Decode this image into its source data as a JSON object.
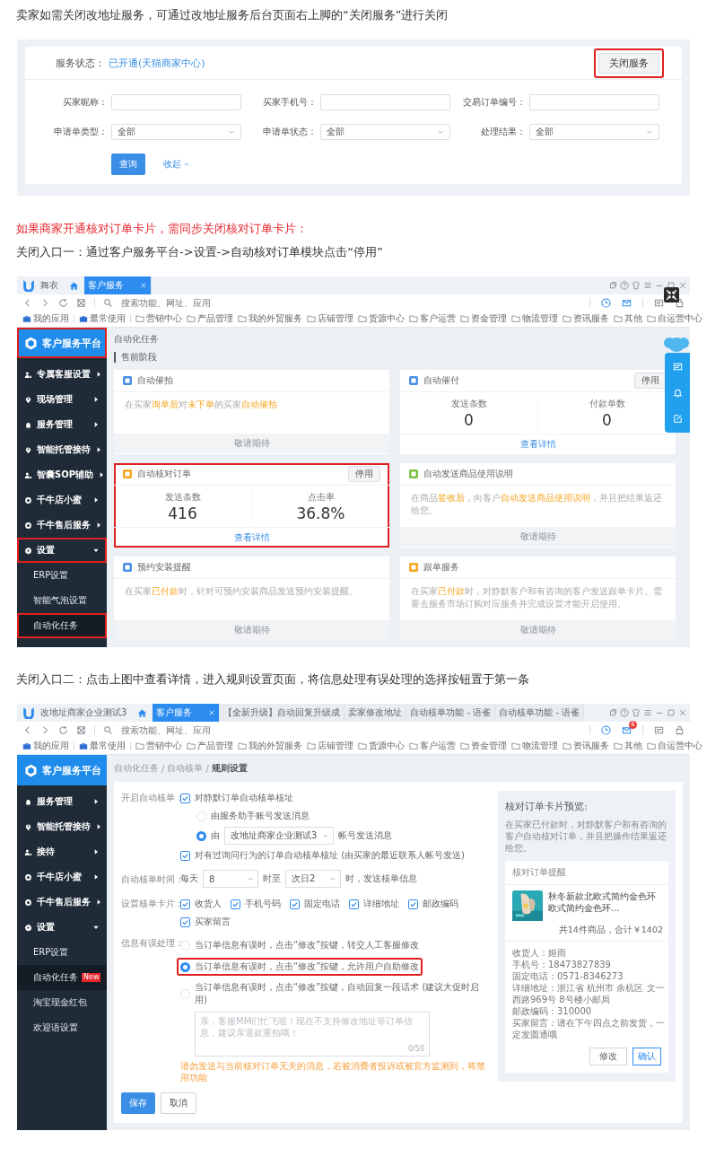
{
  "blocks": [
    {
      "kind": "paragraph",
      "alert": false,
      "text": "卖家如需关闭改地址服务，可通过改地址服务后台页面右上脚的“关闭服务”进行关闭"
    },
    {
      "kind": "service_panel",
      "status_label": "服务状态：",
      "status_value": "已开通(天猫商家中心)",
      "close_button": {
        "label": "关闭服务",
        "highlighted": true
      },
      "fields": [
        {
          "label": "买家昵称：",
          "kind": "input"
        },
        {
          "label": "买家手机号：",
          "kind": "input"
        },
        {
          "label": "交易订单编号：",
          "kind": "input"
        },
        {
          "label": "申请单类型：",
          "kind": "select",
          "value": "全部"
        },
        {
          "label": "申请单状态：",
          "kind": "select",
          "value": "全部"
        },
        {
          "label": "处理结果：",
          "kind": "select",
          "value": "全部"
        }
      ],
      "query_button": "查询",
      "collapse_link": "收起"
    },
    {
      "kind": "paragraph",
      "alert": true,
      "text": "如果商家开通核对订单卡片，需同步关闭核对订单卡片："
    },
    {
      "kind": "paragraph",
      "alert": false,
      "text": "关闭入口一：通过客户服务平台->设置->自动核对订单模块点击“停用”"
    },
    {
      "kind": "client_window",
      "zoom_overlay": true,
      "app_name": "舞衣",
      "tabs": [
        {
          "label": "客户服务",
          "selected": true
        }
      ],
      "search_placeholder": "搜索功能、网址、应用",
      "bookmarks": [
        {
          "label": "我的应用",
          "kind": "group"
        },
        {
          "label": "最常使用",
          "kind": "group"
        },
        {
          "label": "营销中心",
          "kind": "folder"
        },
        {
          "label": "产品管理",
          "kind": "folder"
        },
        {
          "label": "我的外贸服务",
          "kind": "folder"
        },
        {
          "label": "店铺管理",
          "kind": "folder"
        },
        {
          "label": "货源中心",
          "kind": "folder"
        },
        {
          "label": "客户运营",
          "kind": "folder"
        },
        {
          "label": "资金管理",
          "kind": "folder"
        },
        {
          "label": "物流管理",
          "kind": "folder"
        },
        {
          "label": "资讯服务",
          "kind": "folder"
        },
        {
          "label": "其他",
          "kind": "folder"
        },
        {
          "label": "自运营中心",
          "kind": "folder"
        }
      ],
      "sidebar": {
        "title": "客户服务平台",
        "highlighted": true,
        "items": [
          {
            "label": "专属客服设置",
            "expanded": false,
            "highlighted": false
          },
          {
            "label": "现场管理",
            "expanded": false,
            "highlighted": false
          },
          {
            "label": "服务管理",
            "expanded": false,
            "highlighted": false
          },
          {
            "label": "智能托管接待",
            "expanded": false,
            "highlighted": false
          },
          {
            "label": "智囊SOP辅助",
            "expanded": false,
            "highlighted": false
          },
          {
            "label": "千牛店小蜜",
            "expanded": false,
            "highlighted": false
          },
          {
            "label": "千牛售后服务",
            "expanded": false,
            "highlighted": false
          },
          {
            "label": "设置",
            "expanded": true,
            "highlighted": true,
            "children": [
              {
                "label": "ERP设置",
                "selected": false,
                "highlighted": false
              },
              {
                "label": "智能气泡设置",
                "selected": false,
                "highlighted": false
              },
              {
                "label": "自动化任务",
                "selected": true,
                "highlighted": true
              }
            ]
          }
        ]
      },
      "page": {
        "kind": "task_list",
        "title": "自动化任务",
        "section": "售前阶段",
        "cards": [
          {
            "title": "自动催拍",
            "color": "#4a90e2",
            "kind": "description",
            "highlighted": false,
            "description": [
              {
                "text": "在买家",
                "highlight": false
              },
              {
                "text": "询单后",
                "highlight": true
              },
              {
                "text": "对",
                "highlight": false
              },
              {
                "text": "未下单",
                "highlight": true
              },
              {
                "text": "的买家",
                "highlight": false
              },
              {
                "text": "自动催拍",
                "highlight": true
              }
            ],
            "footer": "敬请期待"
          },
          {
            "title": "自动催付",
            "color": "#4a90e2",
            "kind": "stats",
            "highlighted": false,
            "action": "停用",
            "stats": [
              {
                "label": "发送条数",
                "value": "0"
              },
              {
                "label": "付款单数",
                "value": "0"
              }
            ],
            "footer": "查看详情"
          },
          {
            "title": "自动核对订单",
            "color": "#f5a623",
            "kind": "stats",
            "highlighted": true,
            "action": "停用",
            "stats": [
              {
                "label": "发送条数",
                "value": "416"
              },
              {
                "label": "点击率",
                "value": "36.8%"
              }
            ],
            "footer": "查看详情"
          },
          {
            "title": "自动发送商品使用说明",
            "color": "#7ac143",
            "kind": "description",
            "highlighted": false,
            "description": [
              {
                "text": "在商品",
                "highlight": false
              },
              {
                "text": "签收后",
                "highlight": true
              },
              {
                "text": "，向客户",
                "highlight": false
              },
              {
                "text": "自动发送商品使用说明",
                "highlight": true
              },
              {
                "text": "，并且把结果返还给您。",
                "highlight": false
              }
            ],
            "footer": "敬请期待"
          },
          {
            "title": "预约安装提醒",
            "color": "#4a90e2",
            "kind": "description",
            "highlighted": false,
            "description": [
              {
                "text": "在买家",
                "highlight": false
              },
              {
                "text": "已付款",
                "highlight": true
              },
              {
                "text": "时，针对可预约安装商品发送预约安装提醒。",
                "highlight": false
              }
            ],
            "footer": "敬请期待"
          },
          {
            "title": "跟单服务",
            "color": "#f5a623",
            "kind": "description",
            "highlighted": false,
            "description": [
              {
                "text": "在买家",
                "highlight": false
              },
              {
                "text": "已付款",
                "highlight": true
              },
              {
                "text": "时，对静默客户和有咨询的客户发送跟单卡片。需要去服务市场订购对应服务并完成设置才能开启使用。",
                "highlight": false
              }
            ],
            "footer": "敬请期待"
          }
        ]
      }
    },
    {
      "kind": "paragraph",
      "alert": false,
      "text": "关闭入口二：点击上图中查看详情，进入规则设置页面，将信息处理有误处理的选择按钮置于第一条"
    },
    {
      "kind": "client_window",
      "app_name": "改地址商家企业测试3",
      "tabs": [
        {
          "label": "客户服务",
          "selected": true
        },
        {
          "label": "【全新升级】自动回复升级成",
          "selected": false
        },
        {
          "label": "卖家修改地址",
          "selected": false
        },
        {
          "label": "自动核单功能 - 语雀",
          "selected": false
        },
        {
          "label": "自动核单功能 - 语雀",
          "selected": false
        }
      ],
      "mail_badge": "6",
      "search_placeholder": "搜索功能、网址、应用",
      "bookmarks": [
        {
          "label": "我的应用",
          "kind": "group"
        },
        {
          "label": "最常使用",
          "kind": "group"
        },
        {
          "label": "营销中心",
          "kind": "folder"
        },
        {
          "label": "产品管理",
          "kind": "folder"
        },
        {
          "label": "我的外贸服务",
          "kind": "folder"
        },
        {
          "label": "店铺管理",
          "kind": "folder"
        },
        {
          "label": "货源中心",
          "kind": "folder"
        },
        {
          "label": "客户运营",
          "kind": "folder"
        },
        {
          "label": "资金管理",
          "kind": "folder"
        },
        {
          "label": "物流管理",
          "kind": "folder"
        },
        {
          "label": "资讯服务",
          "kind": "folder"
        },
        {
          "label": "其他",
          "kind": "folder"
        },
        {
          "label": "自运营中心",
          "kind": "folder"
        }
      ],
      "sidebar": {
        "title": "客户服务平台",
        "highlighted": false,
        "items": [
          {
            "label": "服务管理",
            "expanded": false
          },
          {
            "label": "智能托管接待",
            "expanded": false
          },
          {
            "label": "接待",
            "expanded": false
          },
          {
            "label": "千牛店小蜜",
            "expanded": false
          },
          {
            "label": "千牛售后服务",
            "expanded": false
          },
          {
            "label": "设置",
            "expanded": true,
            "children": [
              {
                "label": "ERP设置",
                "selected": false
              },
              {
                "label": "自动化任务",
                "selected": true,
                "badge": "New"
              },
              {
                "label": "淘宝现金红包",
                "selected": false
              },
              {
                "label": "欢迎语设置",
                "selected": false
              }
            ]
          }
        ]
      },
      "page": {
        "kind": "rule_settings",
        "breadcrumb": [
          "自动化任务",
          "自动核单",
          "规则设置"
        ],
        "breadcrumb_separator": "/",
        "form": {
          "auto_check": {
            "label": "开启自动核单：",
            "options": [
              {
                "kind": "checkbox",
                "text": "对静默订单自动核单核址",
                "checked": true,
                "children": [
                  {
                    "kind": "radio",
                    "text": "由服务助手账号发送消息",
                    "selected": false
                  },
                  {
                    "kind": "radio_select",
                    "prefix": "由",
                    "value": "改地址商家企业测试3",
                    "suffix": "帐号发送消息",
                    "selected": true
                  }
                ]
              },
              {
                "kind": "checkbox",
                "text": "对有过询问行为的订单自动核单核址 (由买家的最近联系人帐号发送)",
                "checked": true
              }
            ]
          },
          "schedule": {
            "label": "自动核单时间：",
            "prefix": "每天",
            "start": "8",
            "middle": "时至",
            "end": "次日2",
            "suffix": "时，发送核单信息"
          },
          "card_fields": {
            "label": "设置核单卡片：",
            "options": [
              {
                "text": "收货人",
                "checked": true
              },
              {
                "text": "手机号码",
                "checked": true
              },
              {
                "text": "固定电话",
                "checked": true
              },
              {
                "text": "详细地址",
                "checked": true
              },
              {
                "text": "邮政编码",
                "checked": true
              },
              {
                "text": "买家留言",
                "checked": true
              }
            ]
          },
          "error_handling": {
            "label": "信息有误处理：",
            "options": [
              {
                "text": "当订单信息有误时，点击“修改”按键，转交人工客服修改",
                "selected": false,
                "highlighted": false
              },
              {
                "text": "当订单信息有误时，点击“修改”按键，允许用户自助修改",
                "selected": true,
                "highlighted": true
              },
              {
                "text": "当订单信息有误时，点击“修改”按键，自动回复一段话术 (建议大促时启用)",
                "selected": false,
                "highlighted": false
              }
            ],
            "reply": {
              "placeholder": "亲，客服MM们忙飞啦！现在不支持修改地址等订单信息，建议亲退款重拍哦！",
              "counter": "0/50"
            },
            "warning": "请勿发送与当前核对订单无关的消息，若被消费者投诉或被官方监测到，将禁用功能"
          },
          "buttons": [
            {
              "label": "保存",
              "kind": "primary"
            },
            {
              "label": "取消",
              "kind": "default"
            }
          ]
        },
        "preview": {
          "title": "核对订单卡片预览:",
          "description": "在买家已付款时，对静默客户和有咨询的客户自动核对订单，并且把操作结果返还给您。",
          "card_title": "核对订单提醒",
          "product_name": "秋冬新款北欧式简约金色环欧式简约金色环...",
          "summary": "共14件商品，合计￥1402",
          "details": [
            "收货人：姬雨",
            "手机号：18473827839",
            "固定电话：0571-8346273",
            "详细地址：浙江省 杭州市 余杭区 文一西路969号 8号楼小邮局",
            "邮政编码：310000",
            "买家留言：请在下午四点之前发货，一定发圆通哦"
          ],
          "buttons": [
            {
              "label": "修改",
              "kind": "default"
            },
            {
              "label": "确认",
              "kind": "confirm"
            }
          ]
        }
      }
    }
  ]
}
